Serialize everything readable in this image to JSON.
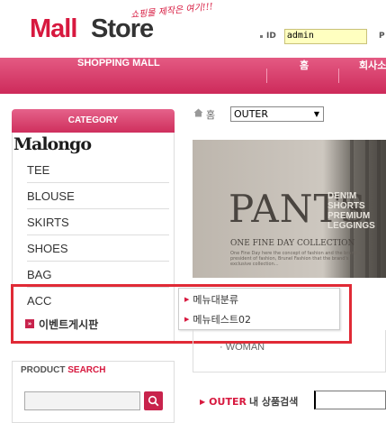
{
  "header": {
    "logo_mall": "Mall",
    "logo_store": "Store",
    "logo_tagline": "쇼핑몰 제작은 여기!!!",
    "id_label": "ID",
    "id_value": "admin",
    "pw_label": "P"
  },
  "nav": {
    "shopping_mall": "SHOPPING MALL",
    "home": "홈",
    "company": "회사소"
  },
  "sidebar": {
    "category_title": "CATEGORY",
    "brand": "Malongo",
    "items": [
      {
        "label": "TEE"
      },
      {
        "label": "BLOUSE"
      },
      {
        "label": "SKIRTS"
      },
      {
        "label": "SHOES"
      },
      {
        "label": "BAG"
      },
      {
        "label": "ACC"
      }
    ],
    "event_board": "이벤트게시판"
  },
  "submenu": {
    "items": [
      {
        "label": "메뉴대분류"
      },
      {
        "label": "메뉴테스트02"
      }
    ]
  },
  "product_search": {
    "title_product": "PRODUCT",
    "title_search": "SEARCH"
  },
  "main": {
    "home_label": "홈",
    "category_select": "OUTER",
    "banner": {
      "title": "PANTS",
      "side_text": "DENIM SHORTS PREMIUM LEGGINGS",
      "collection": "ONE FINE DAY COLLECTION",
      "small_text": "One Fine Day here the concept of fashion and the brand's president of fashion, Brunel Fashion that the brand's exclusive collection..."
    },
    "sub_category": "WOMAN",
    "search_category": "OUTER",
    "search_label": "내 상품검색"
  },
  "colors": {
    "accent": "#d7193f",
    "nav_bar": "#d9416d",
    "highlight_frame": "#e02a36",
    "id_field_bg": "#ffffc0"
  }
}
